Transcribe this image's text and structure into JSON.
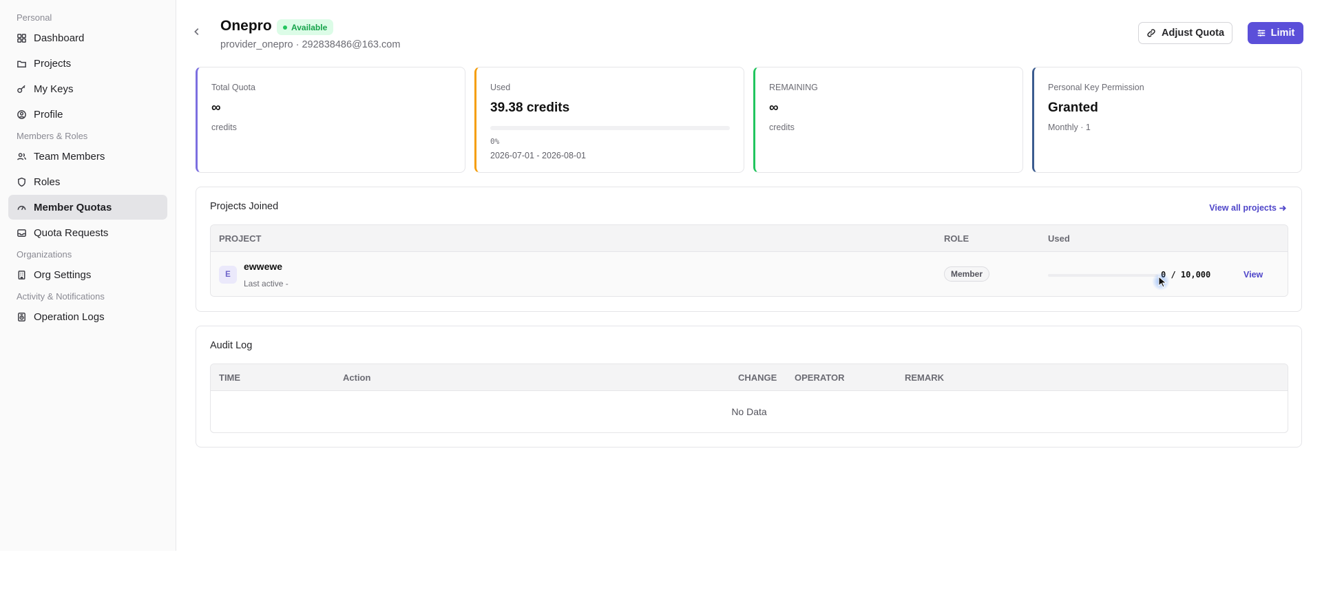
{
  "sidebar": {
    "groups": [
      {
        "label": "Personal",
        "items": [
          {
            "label": "Dashboard",
            "icon": "dashboard-grid-icon"
          },
          {
            "label": "Projects",
            "icon": "folder-icon"
          },
          {
            "label": "My Keys",
            "icon": "key-icon"
          },
          {
            "label": "Profile",
            "icon": "user-circle-icon"
          }
        ]
      },
      {
        "label": "Members & Roles",
        "items": [
          {
            "label": "Team Members",
            "icon": "users-icon"
          },
          {
            "label": "Roles",
            "icon": "shield-icon"
          },
          {
            "label": "Member Quotas",
            "icon": "gauge-icon",
            "active": true
          },
          {
            "label": "Quota Requests",
            "icon": "inbox-icon"
          }
        ]
      },
      {
        "label": "Organizations",
        "items": [
          {
            "label": "Org Settings",
            "icon": "building-icon"
          }
        ]
      },
      {
        "label": "Activity & Notifications",
        "items": [
          {
            "label": "Operation Logs",
            "icon": "log-icon"
          }
        ]
      }
    ]
  },
  "header": {
    "title": "Onepro",
    "status": "Available",
    "subtitle": "provider_onepro · 292838486@163.com",
    "adjust_label": "Adjust Quota",
    "limit_label": "Limit"
  },
  "cards": {
    "total": {
      "label": "Total Quota",
      "value": "∞",
      "unit": "credits",
      "accent": "#7c6fe0"
    },
    "used": {
      "label": "Used",
      "value": "39.38 credits",
      "percent": "0%",
      "progress": 0.0,
      "range": "2026-07-01 - 2026-08-01",
      "accent": "#f59e0b"
    },
    "remaining": {
      "label": "REMAINING",
      "value": "∞",
      "unit": "credits",
      "accent": "#22c55e"
    },
    "permission": {
      "label": "Personal Key Permission",
      "value": "Granted",
      "detail": "Monthly · 1",
      "accent": "#3b5b8f"
    }
  },
  "projects": {
    "title": "Projects Joined",
    "view_all": "View all projects",
    "columns": {
      "project": "PROJECT",
      "role": "ROLE",
      "used": "Used"
    },
    "rows": [
      {
        "avatar": "E",
        "name": "ewwewe",
        "last_active": "Last active -",
        "role": "Member",
        "usage": "0 / 10,000",
        "usage_fraction": 0.0,
        "view": "View"
      }
    ]
  },
  "audit": {
    "title": "Audit Log",
    "columns": {
      "time": "TIME",
      "action": "Action",
      "change": "CHANGE",
      "operator": "OPERATOR",
      "remark": "REMARK"
    },
    "empty": "No Data"
  },
  "colors": {
    "primary": "#5b4fd9",
    "available_bg": "#dcfce7",
    "available_fg": "#16a34a"
  }
}
